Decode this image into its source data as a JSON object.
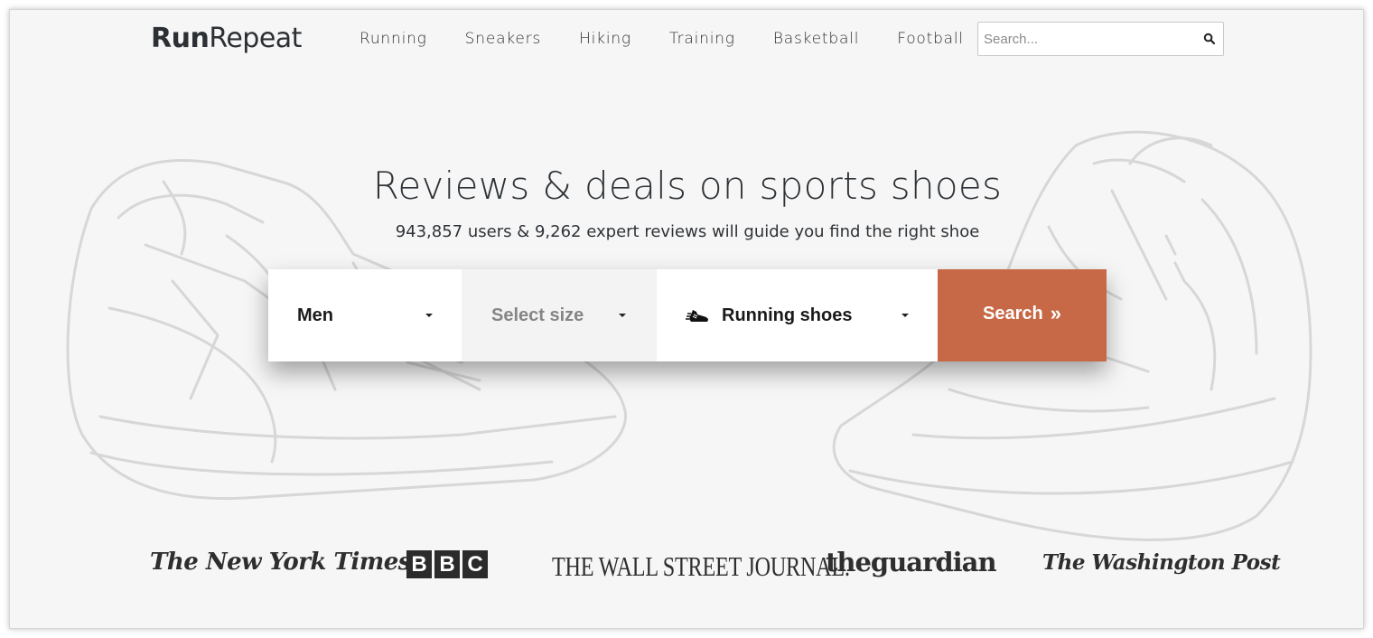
{
  "header": {
    "logo_bold": "Run",
    "logo_light": "Repeat",
    "nav": [
      "Running",
      "Sneakers",
      "Hiking",
      "Training",
      "Basketball",
      "Football"
    ],
    "search_placeholder": "Search..."
  },
  "hero": {
    "title": "Reviews & deals on sports shoes",
    "subtitle": "943,857 users & 9,262 expert reviews will guide you find the right shoe"
  },
  "search_form": {
    "gender": "Men",
    "size": "Select size",
    "type": "Running shoes",
    "button": "Search",
    "button_icon": "double-chevron-right-icon",
    "type_icon": "running-shoe-icon",
    "button_color": "#c76946"
  },
  "press": {
    "nyt": "The New York Times",
    "bbc": [
      "B",
      "B",
      "C"
    ],
    "wsj": "THE WALL STREET JOURNAL.",
    "guardian": "theguardian",
    "wapo": "The Washington Post"
  }
}
